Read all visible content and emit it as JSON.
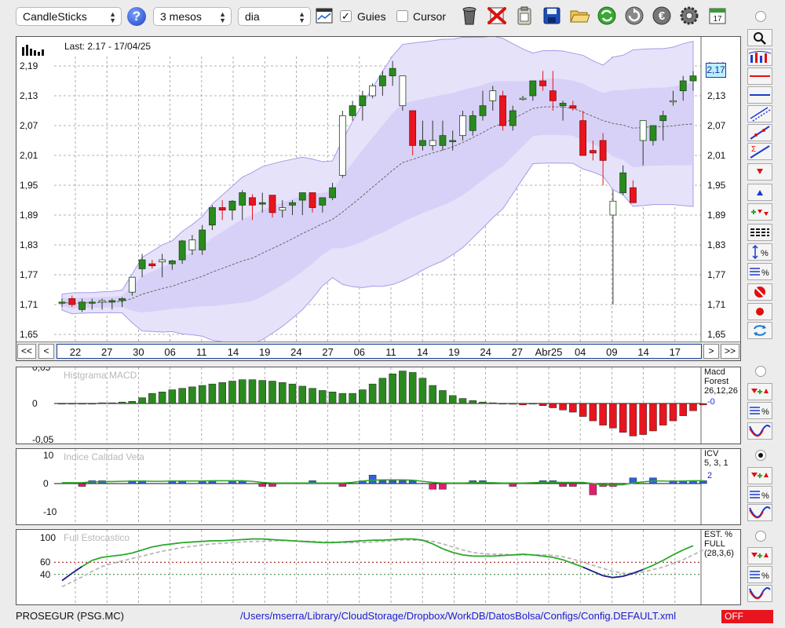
{
  "toolbar": {
    "chart_type": "CandleSticks",
    "period": "3 mesos",
    "interval": "dia",
    "guides_label": "Guies",
    "guides_checked": true,
    "cursor_label": "Cursor",
    "cursor_checked": false,
    "icons": [
      "help-icon",
      "chart-window-icon",
      "trash-icon",
      "delete-icon",
      "clipboard-icon",
      "save-icon",
      "open-folder-icon",
      "refresh-icon",
      "reload-icon",
      "currency-icon",
      "settings-icon",
      "calendar-icon"
    ]
  },
  "main_chart": {
    "last_text": "Last: 2.17 - 17/04/25",
    "price_labels": [
      "2,19",
      "2,13",
      "2,07",
      "2,01",
      "1,95",
      "1,89",
      "1,83",
      "1,77",
      "1,71",
      "1,65"
    ],
    "last_price_label": "2,17",
    "date_labels": [
      "22",
      "27",
      "30",
      "06",
      "11",
      "14",
      "19",
      "24",
      "27",
      "06",
      "11",
      "14",
      "19",
      "24",
      "27",
      "Abr25",
      "04",
      "09",
      "14",
      "17"
    ],
    "nav": {
      "first": "<<",
      "prev": "<",
      "next": ">",
      "last": ">>"
    }
  },
  "macd": {
    "title": "Histgrama MACD",
    "y_labels": [
      "0,05",
      "0",
      "-0,05"
    ],
    "legend": [
      "Macd",
      "Forest",
      "26,12,26"
    ],
    "value": "-0"
  },
  "icv": {
    "title": "Indice Calidad Vela",
    "y_labels": [
      "10",
      "0",
      "-10"
    ],
    "legend": [
      "ICV",
      "5, 3, 1"
    ],
    "value": "2"
  },
  "stoch": {
    "title": "Full Estocastico",
    "y_labels": [
      "100",
      "60",
      "40"
    ],
    "legend": [
      "EST. %",
      "FULL",
      "(28,3,6)"
    ]
  },
  "status": {
    "symbol": "PROSEGUR (PSG.MC)",
    "path": "/Users/mserra/Library/CloudStorage/Dropbox/WorkDB/DatosBolsa/Configs/Config.DEFAULT.xml",
    "off_label": "OFF"
  },
  "colors": {
    "up": "#2a8a1e",
    "down": "#e8141e",
    "band": "#d8d2f5",
    "blue_bar": "#2f5fe0",
    "pink_bar": "#e0206e",
    "accent_line": "#2aa82a"
  },
  "chart_data": {
    "type": "candlestick",
    "ohlc": [
      [
        1.715,
        1.722,
        1.705,
        1.715
      ],
      [
        1.722,
        1.728,
        1.705,
        1.71
      ],
      [
        1.7,
        1.722,
        1.695,
        1.715
      ],
      [
        1.715,
        1.722,
        1.7,
        1.715
      ],
      [
        1.715,
        1.722,
        1.7,
        1.718
      ],
      [
        1.715,
        1.722,
        1.7,
        1.718
      ],
      [
        1.718,
        1.725,
        1.705,
        1.722
      ],
      [
        1.735,
        1.765,
        1.728,
        1.765
      ],
      [
        1.782,
        1.812,
        1.765,
        1.8
      ],
      [
        1.792,
        1.8,
        1.782,
        1.788
      ],
      [
        1.796,
        1.812,
        1.765,
        1.8
      ],
      [
        1.792,
        1.8,
        1.78,
        1.798
      ],
      [
        1.8,
        1.84,
        1.792,
        1.838
      ],
      [
        1.82,
        1.85,
        1.81,
        1.84
      ],
      [
        1.82,
        1.87,
        1.81,
        1.86
      ],
      [
        1.87,
        1.91,
        1.86,
        1.905
      ],
      [
        1.905,
        1.92,
        1.88,
        1.9
      ],
      [
        1.9,
        1.92,
        1.88,
        1.918
      ],
      [
        1.91,
        1.94,
        1.88,
        1.935
      ],
      [
        1.925,
        1.932,
        1.88,
        1.91
      ],
      [
        1.912,
        1.935,
        1.895,
        1.915
      ],
      [
        1.93,
        1.93,
        1.885,
        1.895
      ],
      [
        1.9,
        1.92,
        1.885,
        1.905
      ],
      [
        1.91,
        1.92,
        1.89,
        1.915
      ],
      [
        1.92,
        1.93,
        1.89,
        1.935
      ],
      [
        1.935,
        1.91,
        1.895,
        1.905
      ],
      [
        1.91,
        1.92,
        1.895,
        1.925
      ],
      [
        1.925,
        1.955,
        1.92,
        1.945
      ],
      [
        1.97,
        2.1,
        1.965,
        2.09
      ],
      [
        2.09,
        2.12,
        2.08,
        2.11
      ],
      [
        2.11,
        2.14,
        2.08,
        2.13
      ],
      [
        2.13,
        2.155,
        2.125,
        2.15
      ],
      [
        2.15,
        2.18,
        2.13,
        2.17
      ],
      [
        2.17,
        2.2,
        2.15,
        2.185
      ],
      [
        2.11,
        2.17,
        2.1,
        2.17
      ],
      [
        2.1,
        2.07,
        2.01,
        2.03
      ],
      [
        2.03,
        2.08,
        2.02,
        2.04
      ],
      [
        2.03,
        2.08,
        2.02,
        2.04
      ],
      [
        2.03,
        2.08,
        2.02,
        2.05
      ],
      [
        2.04,
        2.06,
        2.02,
        2.04
      ],
      [
        2.05,
        2.1,
        2.04,
        2.09
      ],
      [
        2.06,
        2.1,
        2.05,
        2.09
      ],
      [
        2.09,
        2.14,
        2.08,
        2.11
      ],
      [
        2.12,
        2.15,
        2.1,
        2.14
      ],
      [
        2.13,
        2.14,
        2.06,
        2.07
      ],
      [
        2.07,
        2.11,
        2.06,
        2.1
      ],
      [
        2.125,
        2.13,
        2.12,
        2.125
      ],
      [
        2.13,
        2.16,
        2.12,
        2.16
      ],
      [
        2.16,
        2.18,
        2.14,
        2.15
      ],
      [
        2.14,
        2.18,
        2.1,
        2.12
      ],
      [
        2.11,
        2.12,
        2.08,
        2.115
      ],
      [
        2.11,
        2.12,
        2.1,
        2.105
      ],
      [
        2.08,
        2.1,
        2.01,
        2.01
      ],
      [
        2.02,
        2.04,
        2.0,
        2.015
      ],
      [
        2.04,
        2.055,
        1.95,
        2.0
      ],
      [
        1.89,
        1.94,
        1.71,
        1.918
      ],
      [
        1.935,
        1.99,
        1.93,
        1.975
      ],
      [
        1.945,
        1.96,
        1.915,
        1.915
      ],
      [
        2.04,
        2.07,
        1.99,
        2.08
      ],
      [
        2.04,
        2.07,
        2.03,
        2.07
      ],
      [
        2.08,
        2.1,
        2.04,
        2.09
      ],
      [
        2.12,
        2.14,
        2.11,
        2.12
      ],
      [
        2.14,
        2.17,
        2.12,
        2.16
      ],
      [
        2.16,
        2.18,
        2.14,
        2.17
      ]
    ],
    "ylim": [
      1.65,
      2.22
    ],
    "macd_hist": [
      0,
      0,
      0,
      0,
      0.001,
      0.001,
      0.002,
      0.003,
      0.008,
      0.014,
      0.016,
      0.019,
      0.021,
      0.023,
      0.025,
      0.027,
      0.029,
      0.031,
      0.033,
      0.033,
      0.032,
      0.031,
      0.029,
      0.027,
      0.024,
      0.021,
      0.018,
      0.016,
      0.014,
      0.014,
      0.019,
      0.027,
      0.035,
      0.041,
      0.045,
      0.043,
      0.035,
      0.025,
      0.018,
      0.011,
      0.007,
      0.004,
      0.002,
      0.001,
      0,
      -0.001,
      -0.002,
      0,
      -0.003,
      -0.006,
      -0.009,
      -0.012,
      -0.018,
      -0.024,
      -0.03,
      -0.034,
      -0.04,
      -0.045,
      -0.043,
      -0.038,
      -0.03,
      -0.024,
      -0.017,
      -0.01,
      -0.002
    ],
    "icv": [
      0,
      0,
      -1,
      1,
      1,
      0,
      0,
      1,
      1,
      0,
      0,
      1,
      1,
      0,
      1,
      1,
      0,
      1,
      1,
      0,
      -1,
      -1,
      0,
      0,
      0,
      1,
      0,
      0,
      -1,
      0,
      1,
      3,
      1,
      1,
      1,
      1,
      0,
      -2,
      -2,
      0,
      0,
      1,
      1,
      0,
      0,
      -1,
      0,
      0,
      1,
      1,
      -1,
      -1,
      0,
      -4,
      -1,
      -1,
      0,
      2,
      0,
      2,
      0,
      1,
      1,
      1,
      1
    ],
    "icv_line": [
      0.3,
      0.3,
      0.3,
      0.6,
      0.7,
      0.7,
      0.8,
      0.9,
      0.9,
      0.8,
      0.8,
      0.9,
      0.9,
      0.9,
      0.9,
      1.0,
      1.0,
      1.0,
      1.0,
      0.8,
      0.4,
      0.2,
      0.2,
      0.2,
      0.2,
      0.2,
      0.2,
      0.2,
      0.2,
      0.4,
      0.9,
      1.2,
      1.3,
      1.3,
      1.3,
      1.2,
      0.8,
      0.4,
      0.2,
      0.2,
      0.2,
      0.3,
      0.3,
      0.3,
      0.2,
      0.2,
      0.2,
      0.3,
      0.4,
      0.4,
      0.4,
      0.4,
      0.4,
      0.0,
      -0.5,
      -0.5,
      -0.4,
      0.2,
      0.6,
      0.9,
      0.9,
      0.8,
      0.9,
      1.0,
      1.0
    ],
    "stoch_k": [
      30,
      42,
      53,
      63,
      68,
      70,
      72,
      75,
      80,
      85,
      88,
      90,
      92,
      93,
      94,
      95,
      95,
      96,
      97,
      98,
      98,
      97,
      96,
      95,
      94,
      93,
      92,
      92,
      93,
      94,
      95,
      96,
      96,
      97,
      98,
      98,
      96,
      90,
      82,
      76,
      72,
      70,
      70,
      70,
      71,
      72,
      73,
      72,
      70,
      68,
      64,
      58,
      52,
      45,
      38,
      35,
      37,
      42,
      48,
      55,
      63,
      72,
      80,
      87,
      94
    ],
    "stoch_d": [
      20,
      28,
      36,
      45,
      53,
      58,
      62,
      66,
      70,
      74,
      78,
      81,
      84,
      86,
      88,
      90,
      91,
      92,
      93,
      94,
      94,
      95,
      95,
      95,
      94,
      94,
      93,
      93,
      92,
      92,
      92,
      93,
      94,
      95,
      96,
      96,
      96,
      94,
      90,
      85,
      80,
      76,
      74,
      73,
      73,
      72,
      72,
      72,
      72,
      71,
      69,
      65,
      60,
      55,
      50,
      45,
      42,
      42,
      44,
      48,
      52,
      58,
      64,
      72,
      80
    ]
  }
}
